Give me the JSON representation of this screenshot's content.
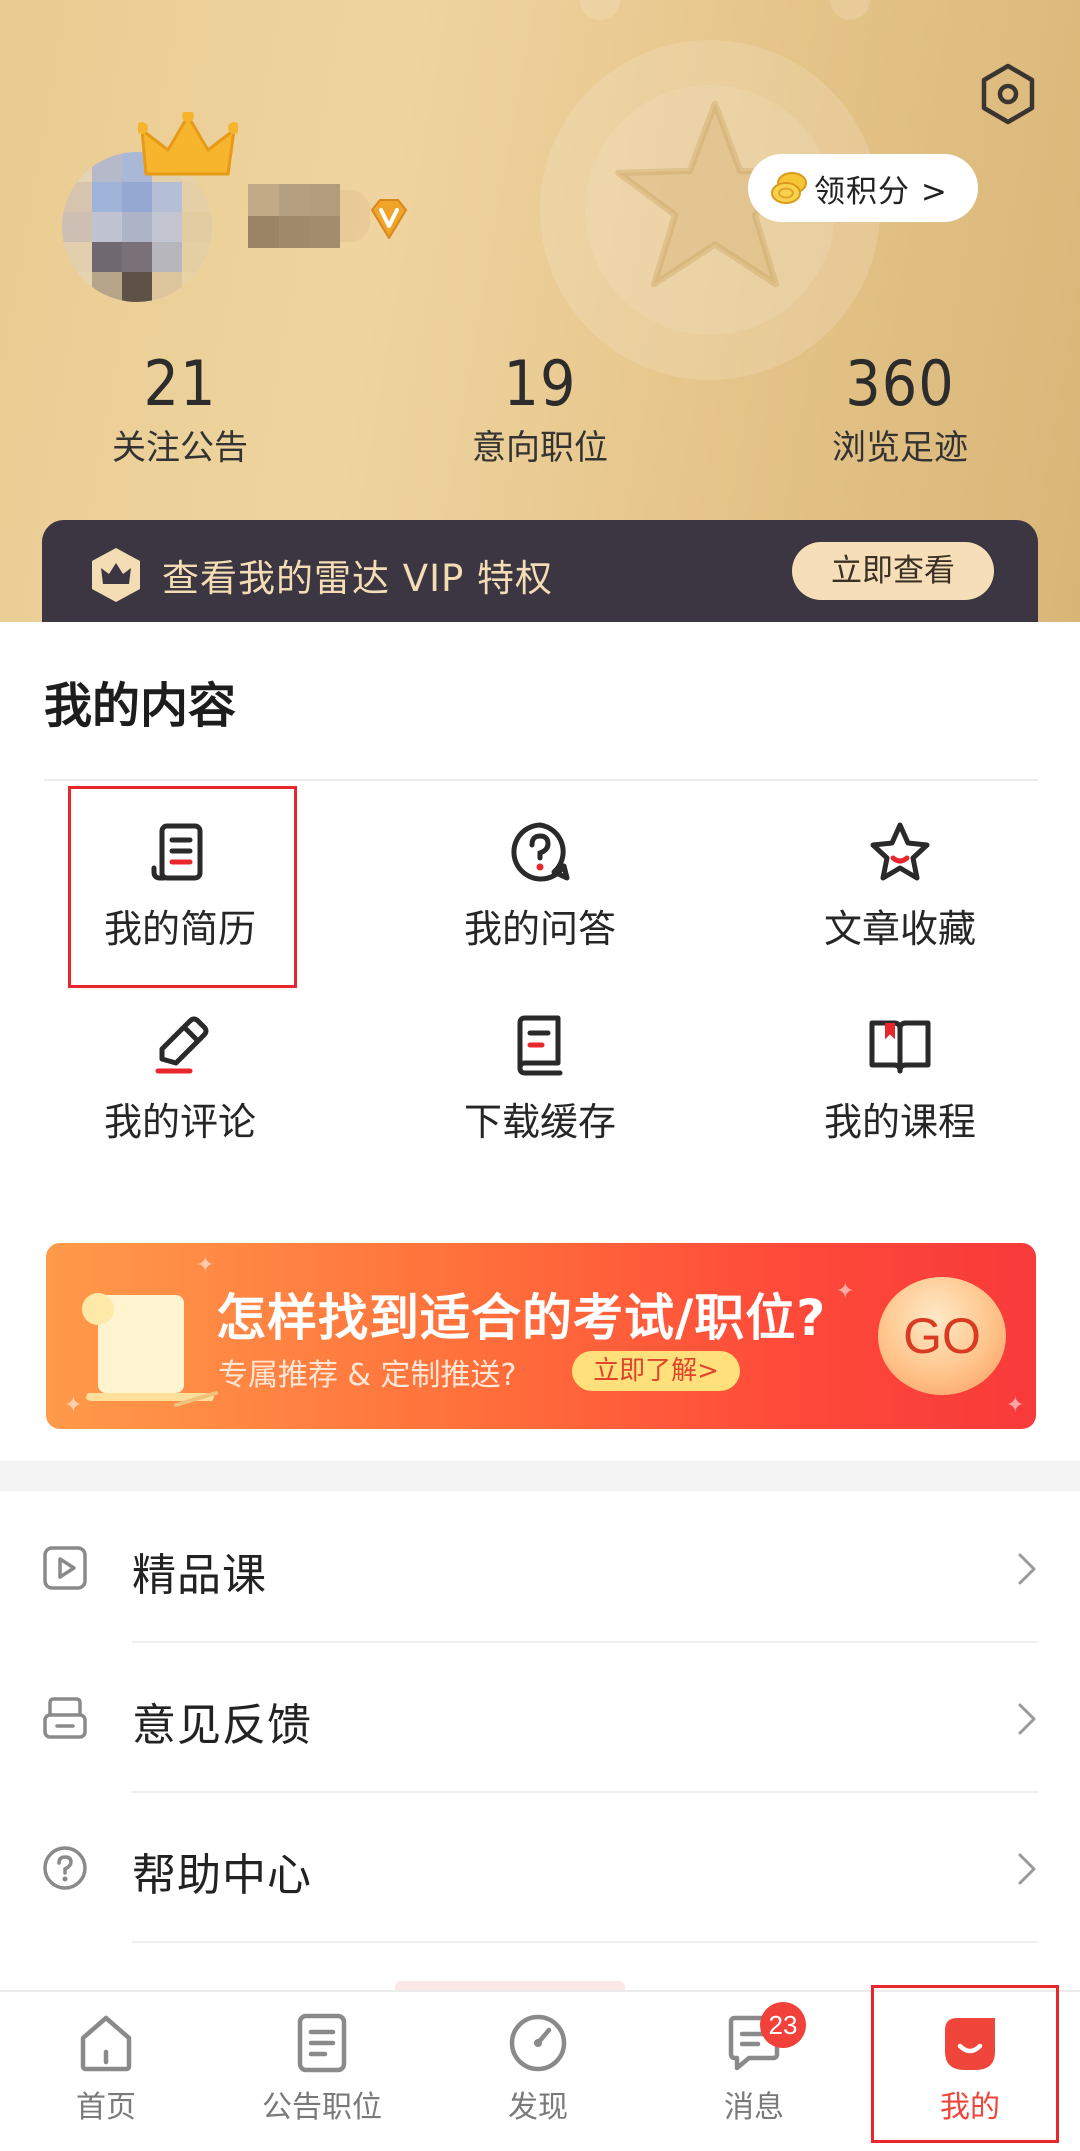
{
  "header": {
    "points_button": "领积分 >",
    "stats": [
      {
        "value": "21",
        "label": "关注公告"
      },
      {
        "value": "19",
        "label": "意向职位"
      },
      {
        "value": "360",
        "label": "浏览足迹"
      }
    ],
    "vip_bar": {
      "text": "查看我的雷达 VIP 特权",
      "button": "立即查看"
    }
  },
  "content": {
    "section_title": "我的内容",
    "grid_items": [
      {
        "label": "我的简历",
        "icon": "resume-icon"
      },
      {
        "label": "我的问答",
        "icon": "question-icon"
      },
      {
        "label": "文章收藏",
        "icon": "star-icon"
      },
      {
        "label": "我的评论",
        "icon": "pen-icon"
      },
      {
        "label": "下载缓存",
        "icon": "download-book-icon"
      },
      {
        "label": "我的课程",
        "icon": "open-book-icon"
      }
    ]
  },
  "banner": {
    "title": "怎样找到适合的考试/职位?",
    "subtitle": "专属推荐 & 定制推送?",
    "pill": "立即了解>",
    "go": "GO"
  },
  "menu": [
    {
      "label": "精品课",
      "icon": "play-icon"
    },
    {
      "label": "意见反馈",
      "icon": "inbox-icon"
    },
    {
      "label": "帮助中心",
      "icon": "help-icon"
    }
  ],
  "bottom_nav": [
    {
      "label": "首页",
      "icon": "home-icon"
    },
    {
      "label": "公告职位",
      "icon": "document-icon"
    },
    {
      "label": "发现",
      "icon": "compass-icon"
    },
    {
      "label": "消息",
      "icon": "message-icon",
      "badge": "23"
    },
    {
      "label": "我的",
      "icon": "profile-icon",
      "active": true
    }
  ],
  "colors": {
    "accent": "#f0453a",
    "header_gold": "#e9cc91",
    "vip_dark": "#3b3641",
    "highlight": "#e8262c"
  }
}
